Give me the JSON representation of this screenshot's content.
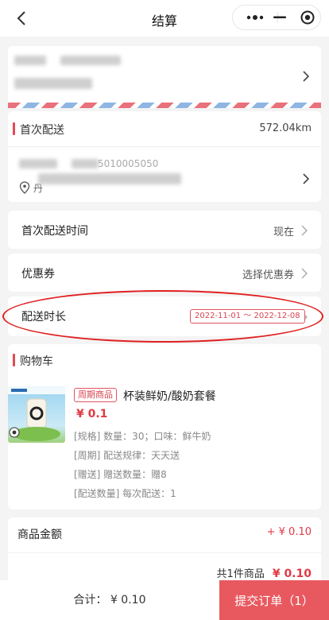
{
  "nav": {
    "title": "结算",
    "back_icon": "chevron-left-icon",
    "capsule_icons": [
      "more-icon",
      "minimize-icon",
      "close-target-icon"
    ]
  },
  "address": {
    "chevron_icon": "chevron-right-icon"
  },
  "delivery": {
    "label": "首次配送",
    "distance": "572.04km",
    "phone_partial": "5010005050",
    "location_icon": "location-pin-icon",
    "location_partial": "丹"
  },
  "first_time": {
    "label": "首次配送时间",
    "value": "现在"
  },
  "coupon": {
    "label": "优惠券",
    "value": "选择优惠券"
  },
  "duration": {
    "label": "配送时长",
    "value": "2022-11-01 ～ 2022-12-08"
  },
  "cart": {
    "title": "购物车",
    "item": {
      "tag": "周期商品",
      "name": "杯装鲜奶/酸奶套餐",
      "price": "¥ 0.1",
      "spec_lines": [
        "[规格] 数量：30；口味：鲜牛奶",
        "[周期] 配送规律：天天送",
        "[赠送] 赠送数量：赠8",
        "[配送数量] 每次配送：1"
      ]
    }
  },
  "summary": {
    "label": "商品金额",
    "amount": "+ ¥ 0.10",
    "count_text": "共1件商品",
    "total": "¥ 0.10"
  },
  "bottom": {
    "sum_text": "合计：  ¥ 0.10",
    "submit_label": "提交订单（1）"
  },
  "colors": {
    "accent": "#e04a55",
    "submit": "#e8595f",
    "price": "#e03a45"
  }
}
